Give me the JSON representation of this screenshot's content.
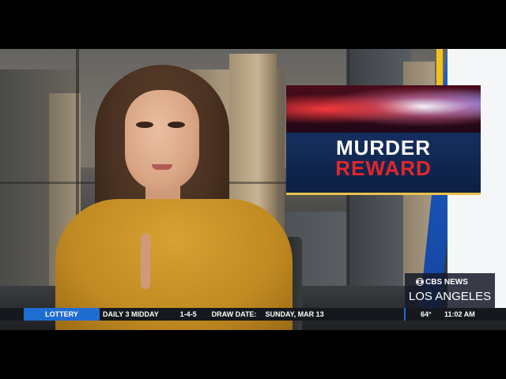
{
  "graphic": {
    "line1": "MURDER",
    "line2": "REWARD"
  },
  "network_bug": {
    "network": "CBS NEWS",
    "city": "LOS ANGELES"
  },
  "ticker": {
    "label": "LOTTERY",
    "game": "DAILY 3 MIDDAY",
    "numbers": "1-4-5",
    "draw_label": "DRAW DATE:",
    "draw_date": "SUNDAY, MAR 13",
    "temperature": "64°",
    "time": "11:02 AM"
  },
  "colors": {
    "ticker_label_bg": "#1f6dd1",
    "reward_red": "#e3262b",
    "graphic_bg": "#142e5d",
    "accent_gold": "#e8c24a"
  }
}
